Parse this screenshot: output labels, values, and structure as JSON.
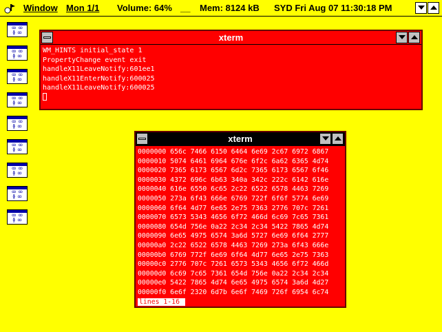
{
  "topbar": {
    "menu_window": "Window",
    "monitor": "Mon 1/1",
    "volume": "Volume: 64%",
    "separator": "__",
    "memory": "Mem: 8124 kB",
    "clock": "SYD Fri Aug 07 11:30:18 PM"
  },
  "desktop_icons": [
    "xterm-launcher-icon",
    "xterm-launcher-icon",
    "xterm-launcher-icon",
    "xterm-launcher-icon",
    "xterm-launcher-icon",
    "xterm-launcher-icon",
    "xterm-launcher-icon",
    "xterm-launcher-icon",
    "xterm-launcher-icon"
  ],
  "window1": {
    "title": "xterm",
    "lines": [
      "WM_HINTS initial_state 1",
      "PropertyChange event exit",
      "handleX11LeaveNotify:601ee1",
      "handleX11EnterNotify:600025",
      "handleX11LeaveNotify:600025"
    ]
  },
  "window2": {
    "title": "xterm",
    "lines": [
      "0000000 656c 7466 6150 6464 6e69 2c67 6972 6867",
      "0000010 5074 6461 6964 676e 6f2c 6a62 6365 4d74",
      "0000020 7365 6173 6567 6d2c 7365 6173 6567 6f46",
      "0000030 4372 696c 6b63 340a 342c 222c 6142 616e",
      "0000040 616e 6550 6c65 2c22 6522 6578 4463 7269",
      "0000050 273a 6f43 666e 6769 722f 6f6f 5774 6e69",
      "0000060 6f64 4d77 6e65 2e75 7363 2776 707c 7261",
      "0000070 6573 5343 4656 6f72 466d 6c69 7c65 7361",
      "0000080 654d 756e 0a22 2c34 2c34 5422 7865 4d74",
      "0000090 6e65 4975 6574 3a6d 5727 6e69 6f64 2777",
      "00000a0 2c22 6522 6578 4463 7269 273a 6f43 666e",
      "00000b0 6769 772f 6e69 6f64 4d77 6e65 2e75 7363",
      "00000c0 2776 707c 7261 6573 5343 4656 6f72 466d",
      "00000d0 6c69 7c65 7361 654d 756e 0a22 2c34 2c34",
      "00000e0 5422 7865 4d74 6e65 4975 6574 3a6d 4d27",
      "00000f0 6e6f 2320 6d7b 6e6f 7469 726f 6954 6c74"
    ],
    "status": "lines 1-16 "
  },
  "colors": {
    "desktop": "#ffff00",
    "window_body": "#ff0000",
    "active_titlebar": "#ff0000",
    "inactive_titlebar": "#000000"
  }
}
